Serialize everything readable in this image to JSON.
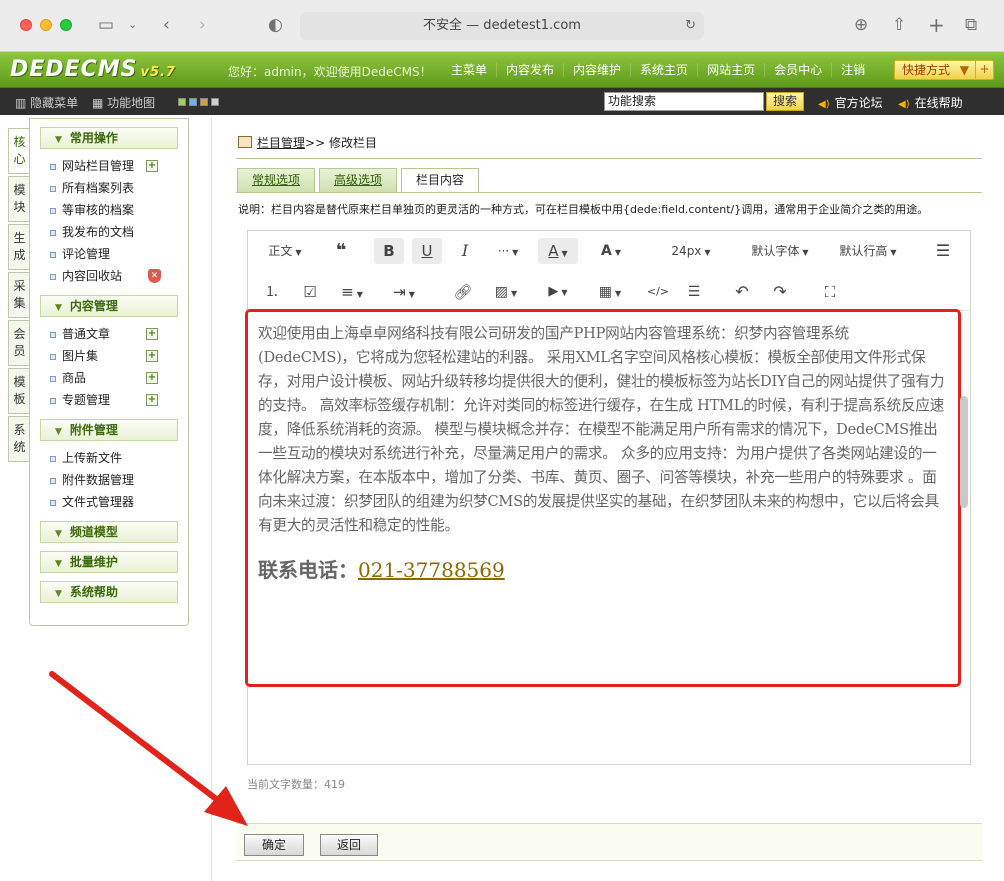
{
  "browser": {
    "url_text": "不安全 — dedetest1.com",
    "reload_icon": "reload-icon"
  },
  "header": {
    "logo": "DEDECMS",
    "version": "v5.7",
    "welcome": "您好：admin，欢迎使用DedeCMS！",
    "nav": [
      "主菜单",
      "内容发布",
      "内容维护",
      "系统主页",
      "网站主页",
      "会员中心",
      "注销"
    ],
    "shortcut": "快捷方式",
    "shortcut_plus": "+"
  },
  "subbar": {
    "hide_menu": "隐藏菜单",
    "site_map": "功能地图",
    "search_value": "功能搜索",
    "search_btn": "搜索",
    "forum": "官方论坛",
    "help": "在线帮助",
    "swatch_colors": [
      "#9fd34a",
      "#6ab4e8",
      "#c9a24a",
      "#d0d0d0"
    ]
  },
  "vtabs": [
    "核心",
    "模块",
    "生成",
    "采集",
    "会员",
    "模板",
    "系统"
  ],
  "sidebar": {
    "groups": [
      {
        "title": "常用操作",
        "items": [
          "网站栏目管理",
          "所有档案列表",
          "等审核的档案",
          "我发布的文档",
          "评论管理",
          "内容回收站"
        ]
      },
      {
        "title": "内容管理",
        "items": [
          "普通文章",
          "图片集",
          "商品",
          "专题管理"
        ]
      },
      {
        "title": "附件管理",
        "items": [
          "上传新文件",
          "附件数据管理",
          "文件式管理器"
        ]
      },
      {
        "title": "频道模型",
        "items": []
      },
      {
        "title": "批量维护",
        "items": []
      },
      {
        "title": "系统帮助",
        "items": []
      }
    ]
  },
  "main": {
    "crumb_link": "栏目管理",
    "crumb_rest": ">> 修改栏目",
    "tabs": [
      "常规选项",
      "高级选项",
      "栏目内容"
    ],
    "note": "说明：栏目内容是替代原来栏目单独页的更灵活的一种方式，可在栏目模板中用{dede:field.content/}调用，通常用于企业简介之类的用途。",
    "toolbar": {
      "paragraph": "正文",
      "font_size": "24px",
      "font_family": "默认字体",
      "line_height": "默认行高",
      "more": "···"
    },
    "content_text": "欢迎使用由上海卓卓网络科技有限公司研发的国产PHP网站内容管理系统：织梦内容管理系统 (DedeCMS)，它将成为您轻松建站的利器。 采用XML名字空间风格核心模板：模板全部使用文件形式保存，对用户设计模板、网站升级转移均提供很大的便利，健壮的模板标签为站长DIY自己的网站提供了强有力的支持。 高效率标签缓存机制：允许对类同的标签进行缓存，在生成 HTML的时候，有利于提高系统反应速度，降低系统消耗的资源。 模型与模块概念并存：在模型不能满足用户所有需求的情况下，DedeCMS推出一些互动的模块对系统进行补充，尽量满足用户的需求。 众多的应用支持：为用户提供了各类网站建设的一体化解决方案，在本版本中，增加了分类、书库、黄页、圈子、问答等模块，补充一些用户的特殊要求 。面向未来过渡：织梦团队的组建为织梦CMS的发展提供坚实的基础，在织梦团队未来的构想中，它以后将会具有更大的灵活性和稳定的性能。",
    "phone_label": "联系电话：",
    "phone_number": "021-37788569",
    "count_label": "当前文字数量：419",
    "ok_btn": "确定",
    "back_btn": "返回"
  },
  "colors": {
    "accent_green": "#6fa82a",
    "highlight_red": "#e2231a",
    "phone_gold": "#8a6b00"
  }
}
